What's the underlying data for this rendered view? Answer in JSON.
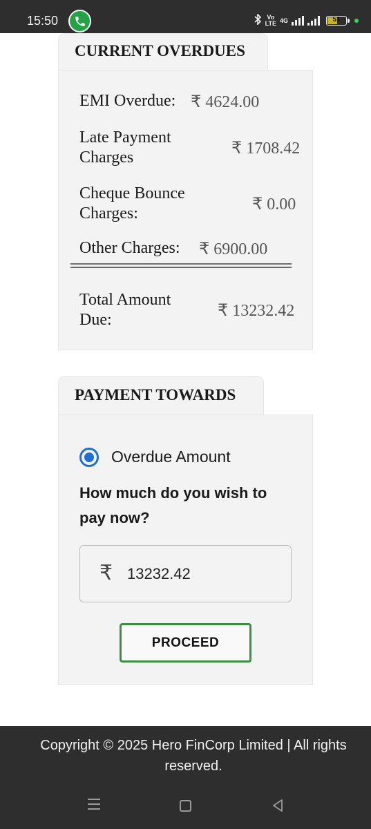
{
  "status_bar": {
    "time": "15:50",
    "volte_top": "Vo",
    "volte_bottom": "LTE",
    "network": "4G",
    "battery": "51"
  },
  "overdues": {
    "title": "CURRENT OVERDUES",
    "rows": [
      {
        "label": "EMI Overdue:",
        "amount": "₹ 4624.00"
      },
      {
        "label": "Late Payment Charges",
        "amount": "₹ 1708.42"
      },
      {
        "label": "Cheque Bounce Charges:",
        "amount": "₹ 0.00"
      },
      {
        "label": "Other Charges:",
        "amount": "₹ 6900.00"
      }
    ],
    "total_label": "Total Amount Due:",
    "total_amount": "₹ 13232.42"
  },
  "payment": {
    "title": "PAYMENT TOWARDS",
    "option_label": "Overdue Amount",
    "question": "How much do you wish to pay now?",
    "currency_symbol": "₹",
    "amount_value": "13232.42",
    "proceed_label": "PROCEED"
  },
  "footer": {
    "copyright": "Copyright © 2025 Hero FinCorp Limited | All rights reserved."
  },
  "colors": {
    "radio_accent": "#1f6fd1",
    "proceed_border": "#3a8f43",
    "footer_bg": "#2e2e2e"
  }
}
